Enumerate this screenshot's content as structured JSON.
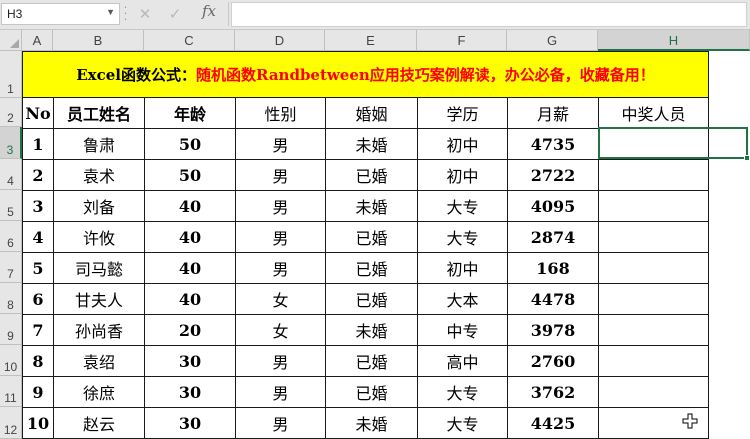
{
  "formula_bar": {
    "name_box": "H3",
    "cancel_icon": "✕",
    "enter_icon": "✓",
    "fx_label": "fx",
    "formula": ""
  },
  "sheet": {
    "columns": [
      "A",
      "B",
      "C",
      "D",
      "E",
      "F",
      "G",
      "H"
    ],
    "rows": [
      "1",
      "2",
      "3",
      "4",
      "5",
      "6",
      "7",
      "8",
      "9",
      "10",
      "11",
      "12"
    ],
    "selected_cell": "H3",
    "title_black": "Excel函数公式：",
    "title_red": "随机函数Randbetween应用技巧案例解读，办公必备，收藏备用！",
    "headers": [
      "No",
      "员工姓名",
      "年龄",
      "性别",
      "婚姻",
      "学历",
      "月薪",
      "中奖人员"
    ],
    "data": [
      {
        "no": "1",
        "name": "鲁肃",
        "age": "50",
        "gender": "男",
        "marriage": "未婚",
        "edu": "初中",
        "salary": "4735",
        "winner": ""
      },
      {
        "no": "2",
        "name": "袁术",
        "age": "50",
        "gender": "男",
        "marriage": "已婚",
        "edu": "初中",
        "salary": "2722",
        "winner": ""
      },
      {
        "no": "3",
        "name": "刘备",
        "age": "40",
        "gender": "男",
        "marriage": "未婚",
        "edu": "大专",
        "salary": "4095",
        "winner": ""
      },
      {
        "no": "4",
        "name": "许攸",
        "age": "40",
        "gender": "男",
        "marriage": "已婚",
        "edu": "大专",
        "salary": "2874",
        "winner": ""
      },
      {
        "no": "5",
        "name": "司马懿",
        "age": "40",
        "gender": "男",
        "marriage": "已婚",
        "edu": "初中",
        "salary": "168",
        "winner": ""
      },
      {
        "no": "6",
        "name": "甘夫人",
        "age": "40",
        "gender": "女",
        "marriage": "已婚",
        "edu": "大本",
        "salary": "4478",
        "winner": ""
      },
      {
        "no": "7",
        "name": "孙尚香",
        "age": "20",
        "gender": "女",
        "marriage": "未婚",
        "edu": "中专",
        "salary": "3978",
        "winner": ""
      },
      {
        "no": "8",
        "name": "袁绍",
        "age": "30",
        "gender": "男",
        "marriage": "已婚",
        "edu": "高中",
        "salary": "2760",
        "winner": ""
      },
      {
        "no": "9",
        "name": "徐庶",
        "age": "30",
        "gender": "男",
        "marriage": "已婚",
        "edu": "大专",
        "salary": "3762",
        "winner": ""
      },
      {
        "no": "10",
        "name": "赵云",
        "age": "30",
        "gender": "男",
        "marriage": "未婚",
        "edu": "大专",
        "salary": "4425",
        "winner": ""
      }
    ]
  },
  "colors": {
    "title_bg": "#ffff00",
    "title_highlight": "#ff0000",
    "selection": "#217346"
  }
}
